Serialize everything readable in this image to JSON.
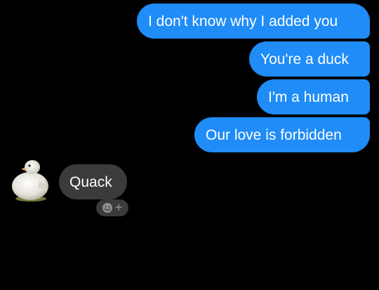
{
  "thread": {
    "sent": [
      {
        "text": "I don't know why I added you"
      },
      {
        "text": "You're a duck"
      },
      {
        "text": "I'm a human"
      },
      {
        "text": "Our love is forbidden"
      }
    ],
    "received": {
      "text": "Quack",
      "avatar_icon": "duck-avatar"
    },
    "reaction_button": {
      "icon": "smiley-add-icon",
      "plus_symbol": "+"
    }
  },
  "colors": {
    "background": "#000000",
    "sent_bubble": "#1f8cf7",
    "received_bubble": "#3a3b3c",
    "text": "#ffffff"
  }
}
